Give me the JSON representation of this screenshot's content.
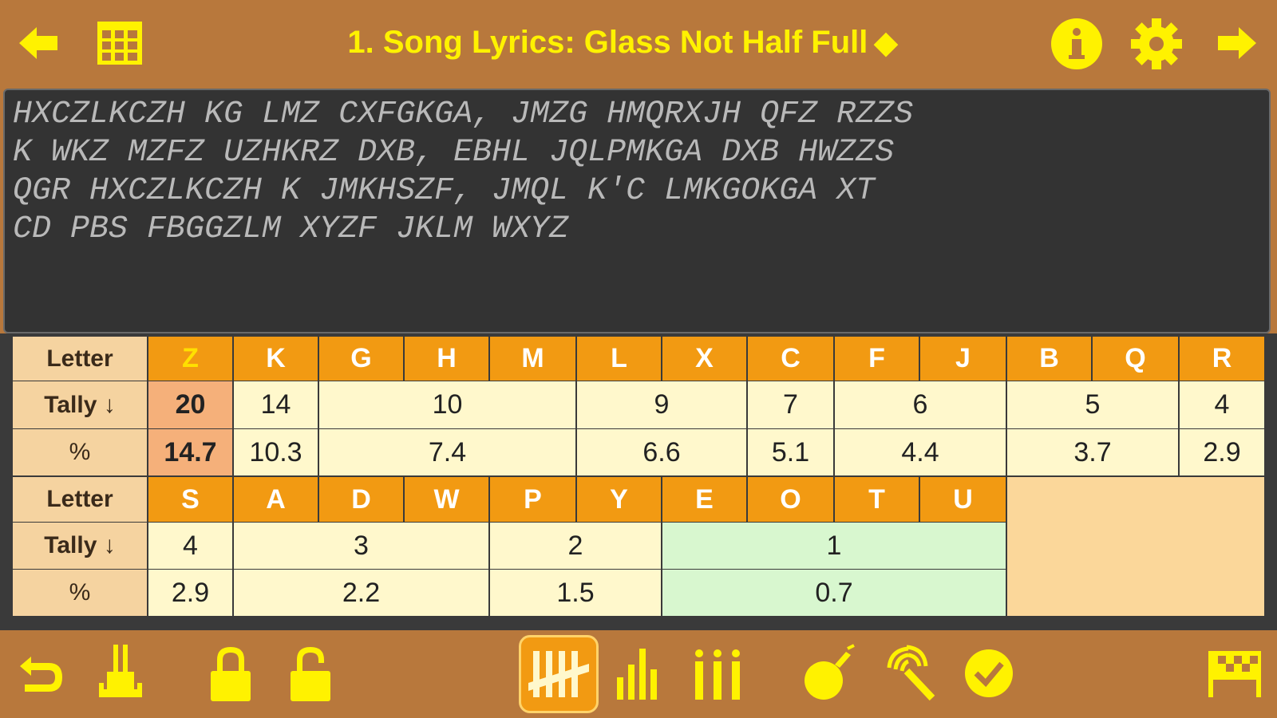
{
  "header": {
    "title": "1. Song Lyrics: Glass Not Half Full",
    "diamond": "◆",
    "icons": [
      "arrow-left-icon",
      "grid-icon",
      "info-icon",
      "gear-icon",
      "arrow-right-icon"
    ]
  },
  "puzzle": {
    "lines": [
      "HXCZLKCZH KG LMZ CXFGKGA, JMZG HMQRXJH QFZ RZZS",
      "K WKZ MZFZ UZHKRZ DXB, EBHL JQLPMKGA DXB HWZZS",
      "QGR HXCZLKCZH K JMKHSZF, JMQL K'C LMKGOKGA XT",
      "CD PBS FBGGZLM XYZF JKLM WXYZ"
    ]
  },
  "tally": {
    "letter_label": "Letter",
    "tally_label": "Tally ↓",
    "pct_label": "%",
    "row1": {
      "letters": [
        "Z",
        "K",
        "G",
        "H",
        "M",
        "L",
        "X",
        "C",
        "F",
        "J",
        "B",
        "Q",
        "R"
      ],
      "tally": [
        "20",
        "14",
        "10",
        "9",
        "7",
        "6",
        "5",
        "4"
      ],
      "pct": [
        "14.7",
        "10.3",
        "7.4",
        "6.6",
        "5.1",
        "4.4",
        "3.7",
        "2.9"
      ]
    },
    "row2": {
      "letters": [
        "S",
        "A",
        "D",
        "W",
        "P",
        "Y",
        "E",
        "O",
        "T",
        "U"
      ],
      "tally": [
        "4",
        "3",
        "2",
        "1"
      ],
      "pct": [
        "2.9",
        "2.2",
        "1.5",
        "0.7"
      ]
    },
    "selected_letter": "Z",
    "colors": {
      "header": "#f29a12",
      "selected": "#ffe000",
      "green": "#d8f7cf"
    }
  },
  "toolbar": {
    "icons": [
      "undo-icon",
      "clear-icon",
      "lock-icon",
      "unlock-icon",
      "tally-icon",
      "bar-chart-icon",
      "columns-icon",
      "bomb-icon",
      "magic-wand-icon",
      "check-icon",
      "finish-flag-icon"
    ],
    "active": "tally-icon"
  }
}
